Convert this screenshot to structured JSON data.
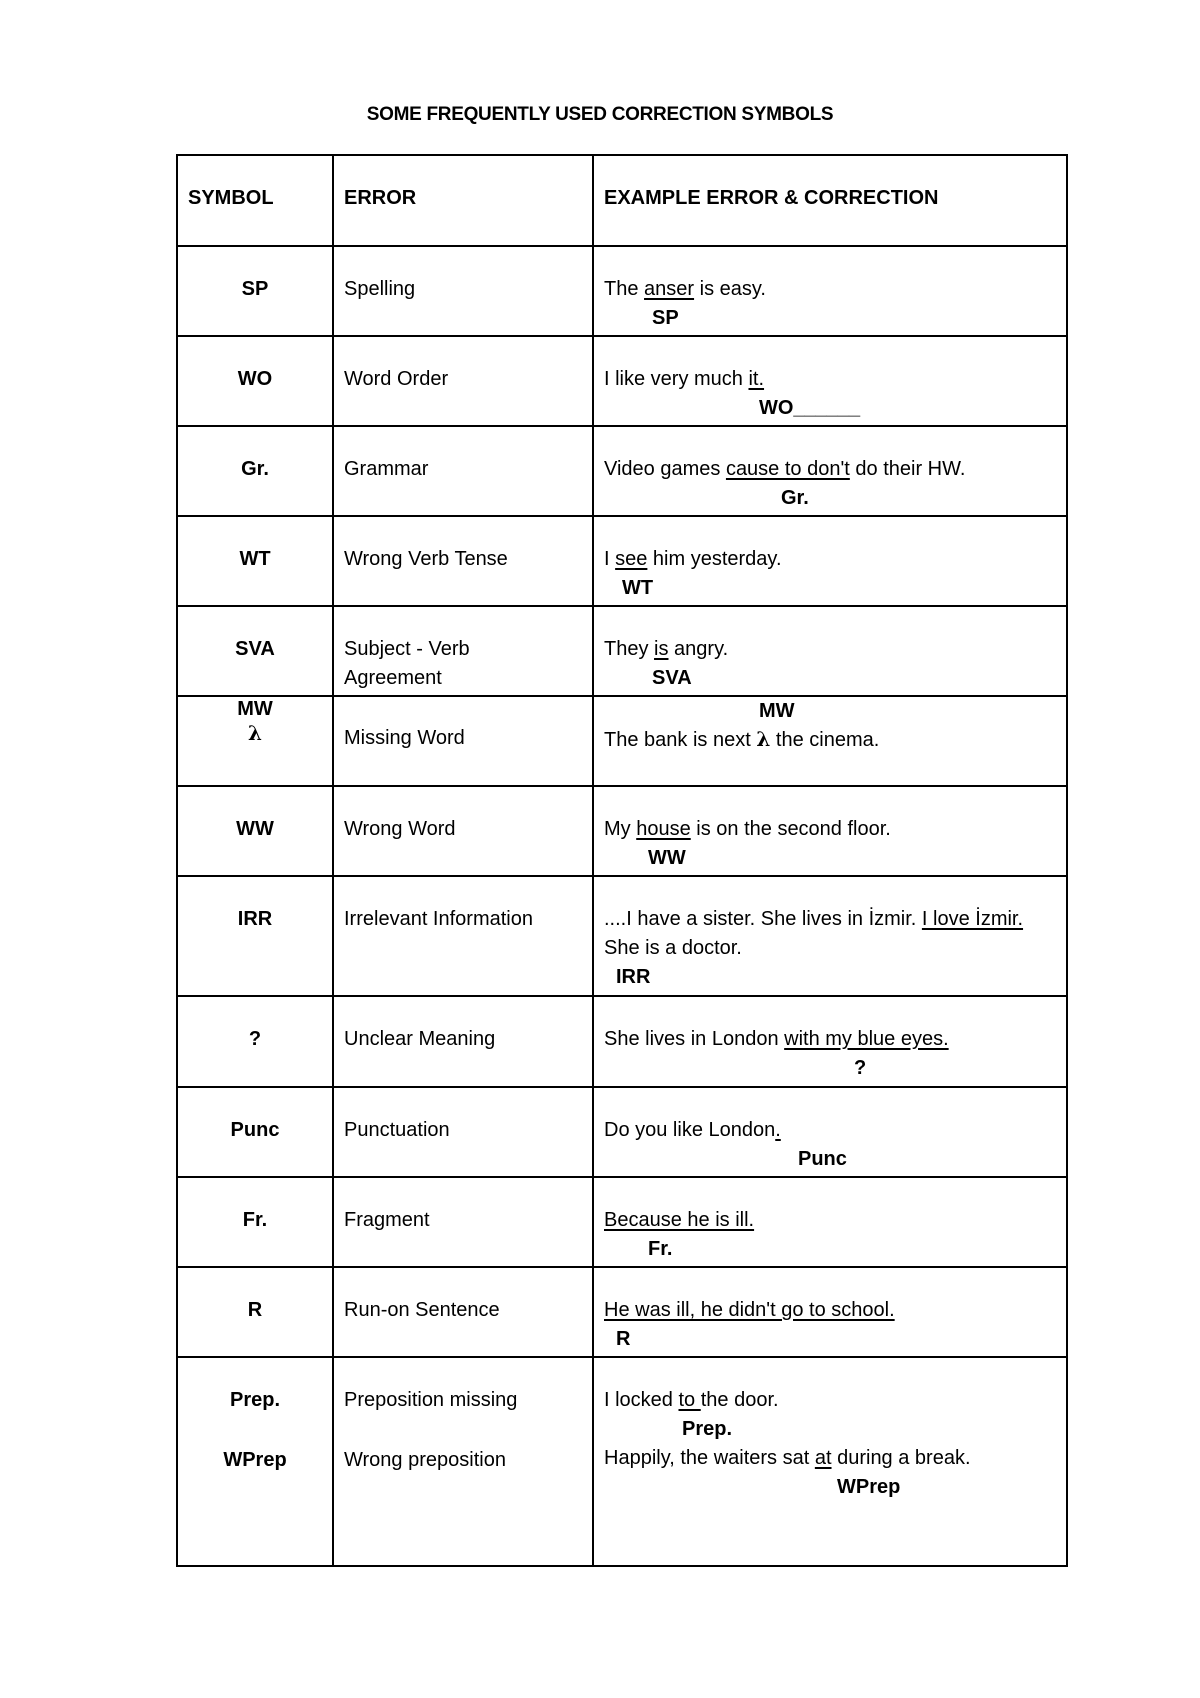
{
  "title": "SOME FREQUENTLY USED CORRECTION SYMBOLS",
  "headers": {
    "symbol": "SYMBOL",
    "error": "ERROR",
    "example": "EXAMPLE ERROR & CORRECTION"
  },
  "rows": [
    {
      "symbol": "SP",
      "error": "Spelling",
      "example": {
        "pre": "The ",
        "underlined": "anser",
        "post": " is easy.",
        "mark": "SP"
      }
    },
    {
      "symbol": "WO",
      "error": "Word Order",
      "example": {
        "pre": "I like very much ",
        "underlined": "it. ",
        "post": "",
        "mark": "WO______"
      }
    },
    {
      "symbol": "Gr.",
      "error": "Grammar",
      "example": {
        "pre": "Video games ",
        "underlined": "cause to don't",
        "post": " do their HW.",
        "mark": "Gr."
      }
    },
    {
      "symbol": "WT",
      "error": "Wrong Verb Tense",
      "example": {
        "pre": "I ",
        "underlined": "see",
        "post": " him yesterday.",
        "mark": "WT"
      }
    },
    {
      "symbol": "SVA",
      "error_line1": "Subject - Verb",
      "error_line2": "Agreement",
      "example": {
        "pre": "They ",
        "underlined": "is",
        "post": " angry.",
        "mark": "SVA"
      }
    },
    {
      "symbol": "MW",
      "symbol_glyph": "λ",
      "error": "Missing Word",
      "example": {
        "mark": "MW",
        "pre": "The bank is next ",
        "glyph": "λ",
        "post": " the cinema."
      }
    },
    {
      "symbol": "WW",
      "error": "Wrong Word",
      "example": {
        "pre": "My ",
        "underlined": "house",
        "post": " is on the second floor.",
        "mark": "WW"
      }
    },
    {
      "symbol": "IRR",
      "error": "Irrelevant Information",
      "example": {
        "pre": "....I have a sister. She lives in İzmir. ",
        "underlined": "I love İzmir.",
        "line2": "She is a doctor.",
        "mark": "IRR"
      }
    },
    {
      "symbol": "?",
      "error": "Unclear Meaning",
      "example": {
        "pre": "She lives in London ",
        "underlined": "with my blue eyes.",
        "post": "",
        "mark": "?"
      }
    },
    {
      "symbol": "Punc",
      "error": "Punctuation",
      "example": {
        "pre": "Do you like London",
        "underlined": ". ",
        "post": "",
        "mark": "Punc"
      }
    },
    {
      "symbol": "Fr.",
      "error": "Fragment",
      "example": {
        "pre": "",
        "underlined": "Because he is ill.",
        "post": "",
        "mark": "Fr."
      }
    },
    {
      "symbol": "R",
      "error": "Run-on Sentence",
      "example": {
        "pre": "",
        "underlined": "He was ill, he didn't go to school.",
        "post": "",
        "mark": "R"
      }
    },
    {
      "symbol": "Prep.",
      "symbol2": "WPrep",
      "error": "Preposition missing",
      "error2": "Wrong preposition",
      "example": {
        "pre": "I locked ",
        "underlined": "to ",
        "post": "the door.",
        "mark": "Prep."
      },
      "example2": {
        "pre": "Happily, the waiters sat ",
        "underlined": "at",
        "post": " during a break.",
        "mark": "WPrep"
      }
    }
  ]
}
